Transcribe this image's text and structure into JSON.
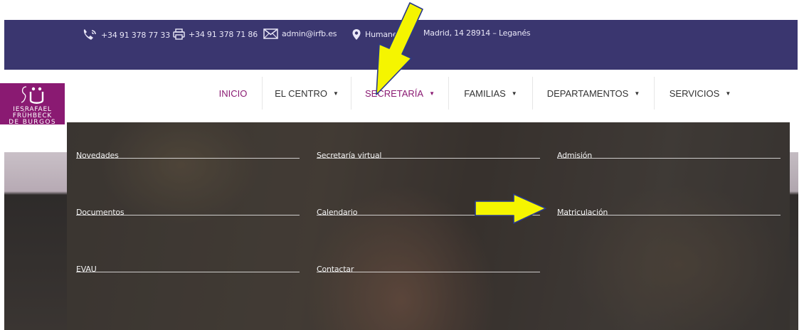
{
  "contact": {
    "phone": "+34 91 378 77 33",
    "fax": "+34 91 378 71 86",
    "email": "admin@irfb.es",
    "address_part1": "Humane",
    "address_part2": "Madrid, 14 28914 – Leganés"
  },
  "logo": {
    "line1": "IESRAFAEL",
    "line2": "FRÜHBECK",
    "line3": "DE BURGOS"
  },
  "nav": {
    "items": [
      {
        "label": "INICIO",
        "caret": ""
      },
      {
        "label": "EL CENTRO",
        "caret": "▼"
      },
      {
        "label": "SECRETARÍA",
        "caret": "▼"
      },
      {
        "label": "FAMILIAS",
        "caret": "▼"
      },
      {
        "label": "DEPARTAMENTOS",
        "caret": "▼"
      },
      {
        "label": "SERVICIOS",
        "caret": "▼"
      }
    ]
  },
  "mega_menu": {
    "col1": [
      "Novedades",
      "Documentos",
      "EVAU"
    ],
    "col2": [
      "Secretaría virtual",
      "Calendario",
      "Contactar"
    ],
    "col3": [
      "Admisión",
      "Matriculación"
    ]
  },
  "colors": {
    "topbar": "#3a366f",
    "brand": "#8a1a72",
    "arrow": "#f5f500"
  },
  "icons": [
    "phone-icon",
    "printer-icon",
    "mail-icon",
    "location-pin-icon",
    "chevron-down-icon"
  ]
}
